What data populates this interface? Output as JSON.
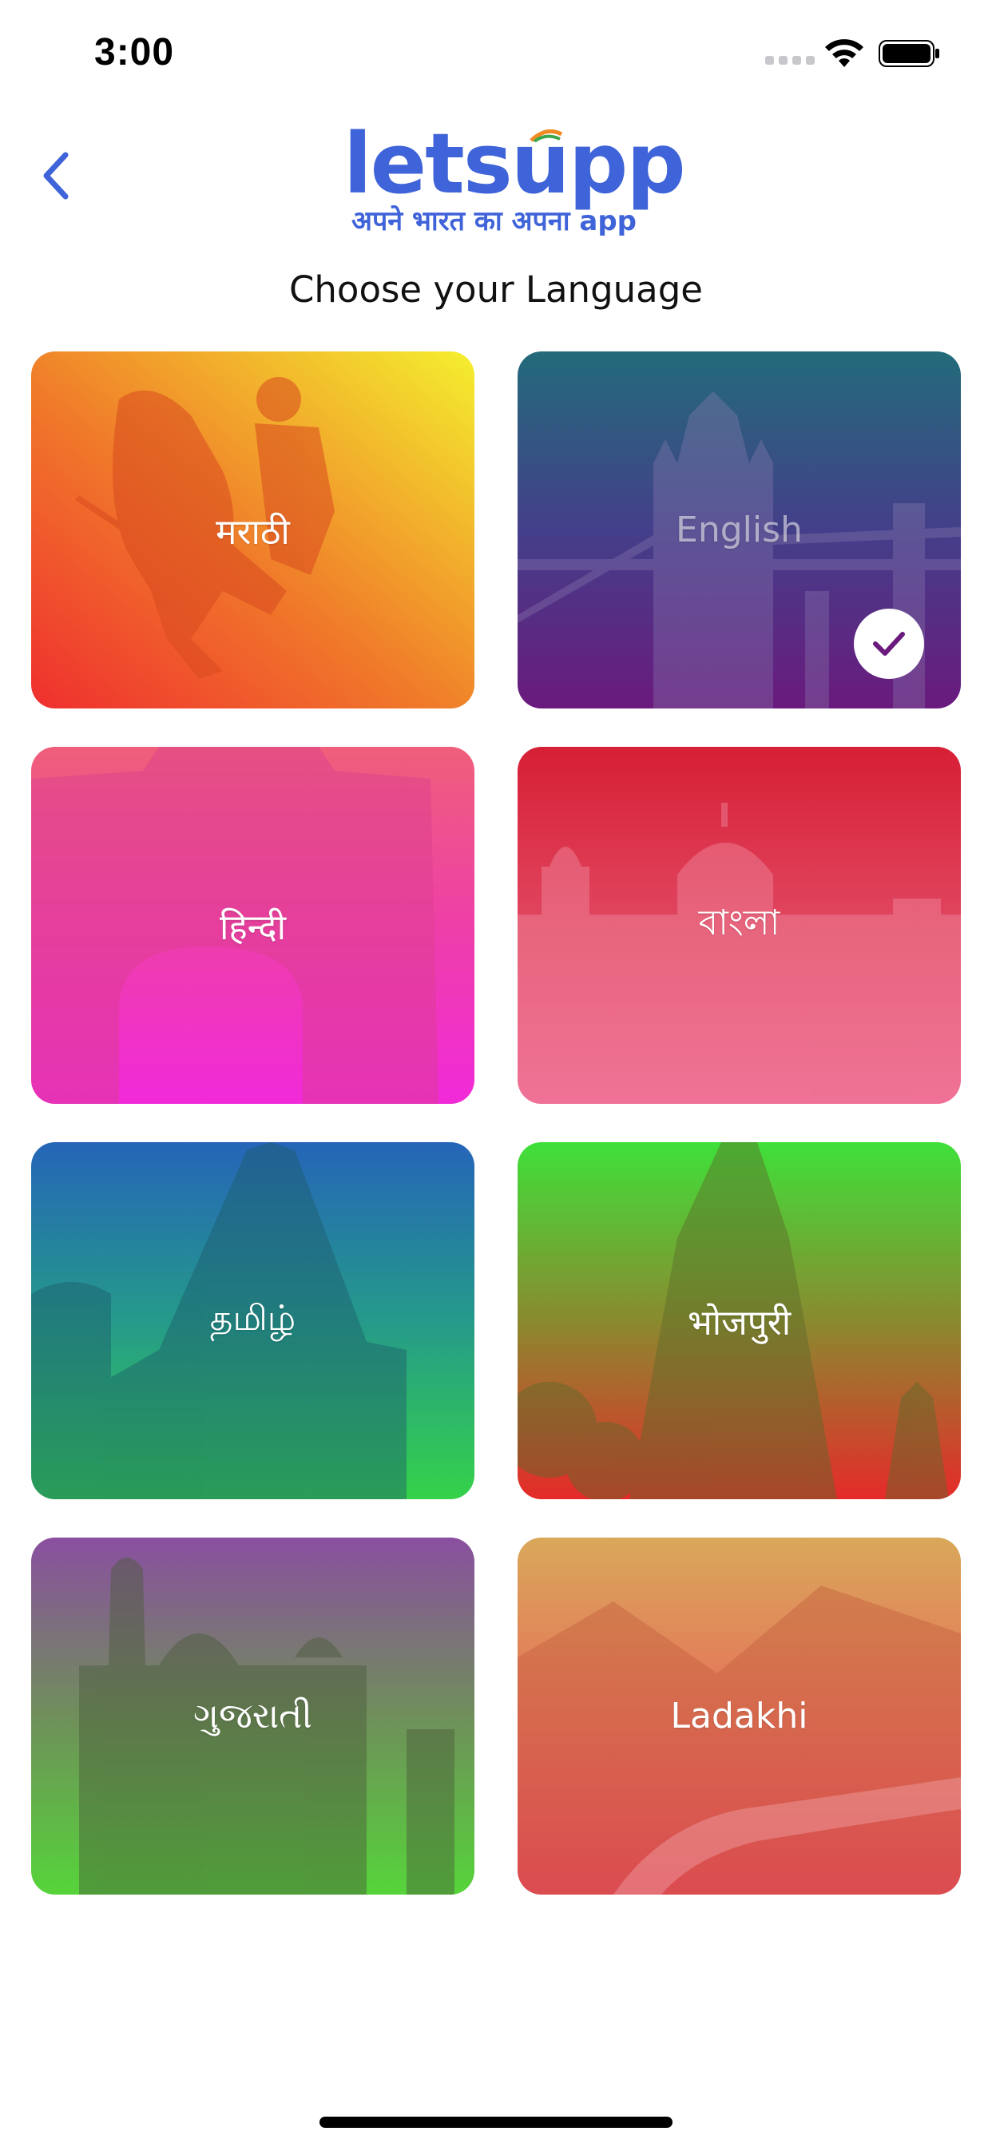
{
  "status_bar": {
    "time": "3:00"
  },
  "header": {
    "logo_text": "letsupp",
    "logo_tagline": "अपने भारत का अपना app"
  },
  "screen_title": "Choose your Language",
  "languages": [
    {
      "label": "मराठी",
      "selected": false,
      "colors": [
        "#f4ef2e",
        "#ef3b2c"
      ]
    },
    {
      "label": "English",
      "selected": true,
      "colors": [
        "#236b7a",
        "#6a1a7d"
      ]
    },
    {
      "label": "हिन्दी",
      "selected": false,
      "colors": [
        "#ef5f7a",
        "#f12ad9"
      ]
    },
    {
      "label": "বাংলা",
      "selected": false,
      "colors": [
        "#d61f35",
        "#ef5f8f"
      ]
    },
    {
      "label": "தமிழ்",
      "selected": false,
      "colors": [
        "#2565b8",
        "#35d24a"
      ]
    },
    {
      "label": "भोजपुरी",
      "selected": false,
      "colors": [
        "#3fe03a",
        "#e62a2a"
      ]
    },
    {
      "label": "ગુજરાતી",
      "selected": false,
      "colors": [
        "#8a4fa0",
        "#56d43a"
      ]
    },
    {
      "label": "Ladakhi",
      "selected": false,
      "colors": [
        "#d9a85a",
        "#ef3b5f"
      ]
    }
  ],
  "accent_color": "#3f63d8",
  "check_color": "#6a1a7d"
}
